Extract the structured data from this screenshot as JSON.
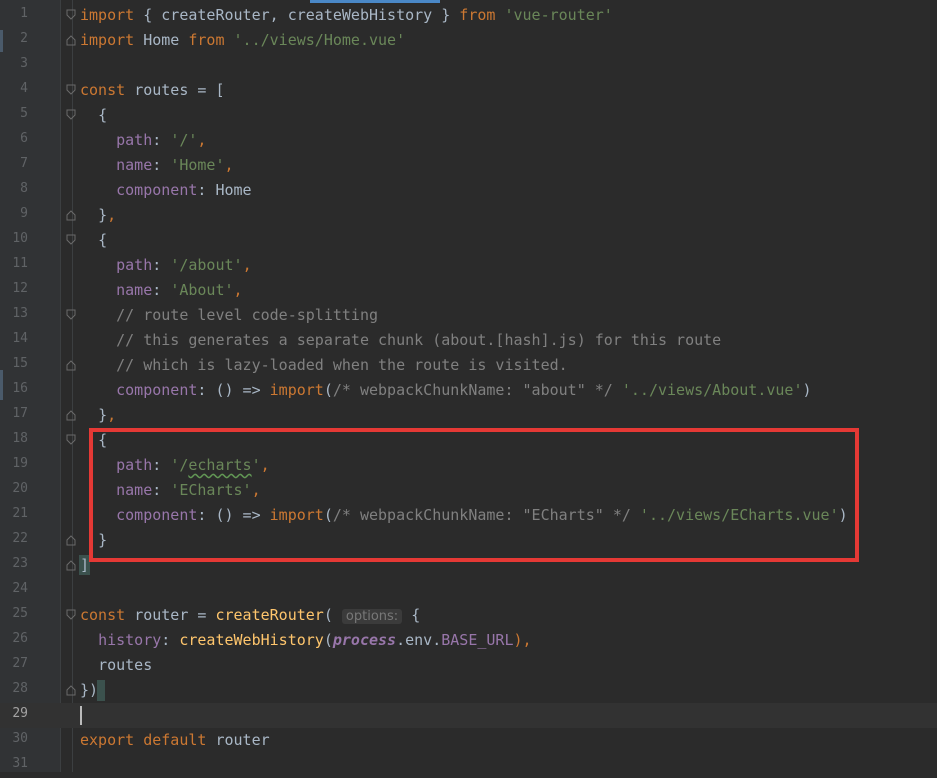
{
  "editor": {
    "language": "javascript",
    "current_line": 29,
    "lines": [
      {
        "n": "1"
      },
      {
        "n": "2"
      },
      {
        "n": "3"
      },
      {
        "n": "4"
      },
      {
        "n": "5"
      },
      {
        "n": "6"
      },
      {
        "n": "7"
      },
      {
        "n": "8"
      },
      {
        "n": "9"
      },
      {
        "n": "10"
      },
      {
        "n": "11"
      },
      {
        "n": "12"
      },
      {
        "n": "13"
      },
      {
        "n": "14"
      },
      {
        "n": "15"
      },
      {
        "n": "16"
      },
      {
        "n": "17"
      },
      {
        "n": "18"
      },
      {
        "n": "19"
      },
      {
        "n": "20"
      },
      {
        "n": "21"
      },
      {
        "n": "22"
      },
      {
        "n": "23"
      },
      {
        "n": "24"
      },
      {
        "n": "25"
      },
      {
        "n": "26"
      },
      {
        "n": "27"
      },
      {
        "n": "28"
      },
      {
        "n": "29"
      },
      {
        "n": "30"
      },
      {
        "n": "31"
      }
    ],
    "tokens": {
      "import": "import",
      "from": "from",
      "const": "const",
      "export": "export",
      "default": "default",
      "l1_names": "{ createRouter, createWebHistory }",
      "l1_mod": "'vue-router'",
      "l2_name": "Home",
      "l2_mod": "'../views/Home.vue'",
      "routes": "routes",
      "eq_open": "= [",
      "open_brace": "{",
      "close_brace": "}",
      "close_brace_comma": "},",
      "close_bracket": "]",
      "close_paren_brace": "})",
      "path": "path",
      "name": "name",
      "component": "component",
      "colon": ":",
      "comma": ",",
      "home_path": "'/'",
      "home_name": "'Home'",
      "home_component": "Home",
      "about_path": "'/about'",
      "about_name": "'About'",
      "comment1": "// route level code-splitting",
      "comment2": "// this generates a separate chunk (about.[hash].js) for this route",
      "comment3": "// which is lazy-loaded when the route is visited.",
      "arrow": "() =>",
      "about_chunk": "/* webpackChunkName: \"about\" */",
      "about_file": "'../views/About.vue'",
      "echarts_path_q1": "'/",
      "echarts_path_word": "echarts",
      "echarts_path_q2": "'",
      "echarts_name": "'ECharts'",
      "echarts_chunk": "/* webpackChunkName: \"ECharts\" */",
      "echarts_file": "'../views/ECharts.vue'",
      "router": "router",
      "createRouter": "createRouter",
      "param_hint": "options:",
      "history": "history",
      "createWebHistory": "createWebHistory",
      "process": "process",
      "env_dot": ".env.",
      "base_url": "BASE_URL",
      "close_call_comma": "),"
    }
  },
  "annotation": {
    "color": "#e53935"
  }
}
